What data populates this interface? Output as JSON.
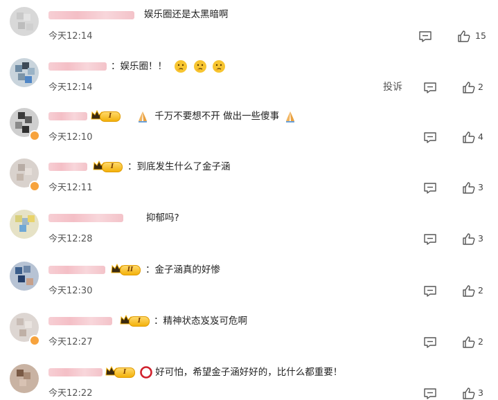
{
  "report_label": "投诉",
  "vip_labels": [
    "I",
    "I",
    "I",
    "I",
    "II",
    "I",
    "I"
  ],
  "comments": [
    {
      "text": "娱乐圈还是太黑暗啊",
      "time": "今天12:14",
      "likes": "15"
    },
    {
      "text": "：娱乐圈！！",
      "time": "今天12:14",
      "likes": "2"
    },
    {
      "text": "千万不要想不开 做出一些傻事",
      "time": "今天12:10",
      "likes": "4"
    },
    {
      "text": "：到底发生什么了金子涵",
      "time": "今天12:11",
      "likes": "3"
    },
    {
      "text": "抑郁吗?",
      "time": "今天12:28",
      "likes": "3"
    },
    {
      "text": "：金子涵真的好惨",
      "time": "今天12:30",
      "likes": "2"
    },
    {
      "text": "：精神状态岌岌可危啊",
      "time": "今天12:27",
      "likes": "2"
    },
    {
      "text": "好可怕，希望金子涵好好的，比什么都重要！",
      "time": "今天12:22",
      "likes": "3"
    }
  ],
  "colors": {
    "vip_gold": "#f3b10b",
    "badge_orange": "#f7a33d",
    "name_blur": "#f3b8c0",
    "text": "#222222",
    "meta": "#555555"
  },
  "icons": [
    "comment-icon",
    "like-icon",
    "crown-icon",
    "pray-emoji",
    "thinking-emoji",
    "no-entry-emoji"
  ]
}
